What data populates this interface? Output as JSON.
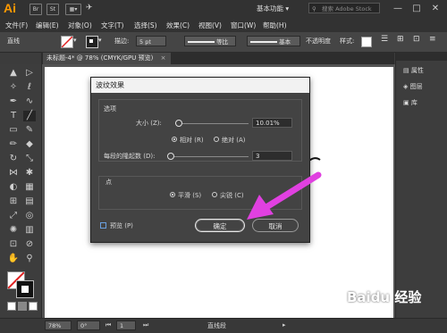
{
  "app": {
    "logo": "Ai",
    "workspace": "基本功能",
    "search_placeholder": "搜索 Adobe Stock",
    "window_buttons": [
      "—",
      "□",
      "✕"
    ]
  },
  "menu": [
    "文件(F)",
    "编辑(E)",
    "对象(O)",
    "文字(T)",
    "选择(S)",
    "效果(C)",
    "视图(V)",
    "窗口(W)",
    "帮助(H)"
  ],
  "control": {
    "selection_label": "直线",
    "stroke_label": "描边:",
    "stroke_value": "5 pt",
    "profile_label": "等比",
    "brush_label": "基本",
    "opacity_label": "不透明度",
    "style_label": "样式:"
  },
  "document_tab": "未标题-4* @ 78% (CMYK/GPU 预览)",
  "right_panel": [
    "属性",
    "图层",
    "库"
  ],
  "status": {
    "zoom": "78%",
    "rotation": "0°",
    "page": "1",
    "tool_name": "直线段"
  },
  "dialog": {
    "title": "波纹效果",
    "options_section": "选项",
    "size_label": "大小 (Z):",
    "size_value": "10.01%",
    "size_fraction": 0.05,
    "relative_label": "相对 (R)",
    "absolute_label": "绝对 (A)",
    "ridges_label": "每段的隆起数 (D):",
    "ridges_value": "3",
    "ridges_fraction": 0.03,
    "points_section": "点",
    "smooth_label": "平滑 (S)",
    "corner_label": "尖锐 (C)",
    "preview_label": "预览 (P)",
    "ok_label": "确定",
    "cancel_label": "取消"
  },
  "watermark": "Baidu 经验",
  "colors": {
    "arrow": "#e040e0",
    "accent": "#ff9a00"
  }
}
